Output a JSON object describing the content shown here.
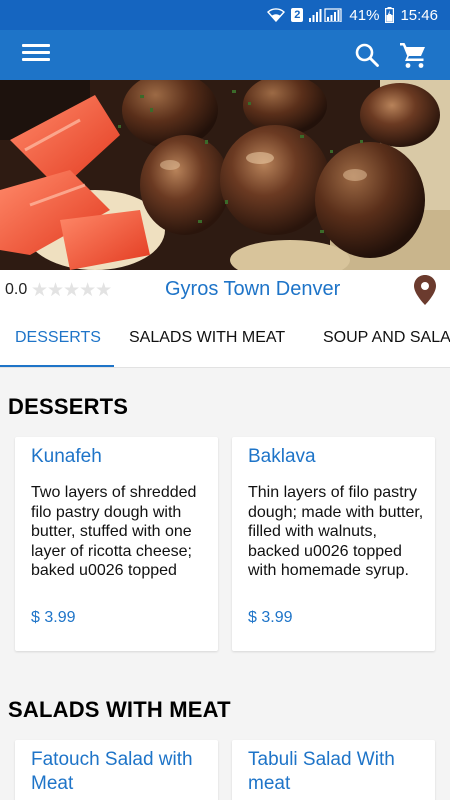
{
  "status_bar": {
    "sim_slot": "2",
    "battery": "41%",
    "time": "15:46"
  },
  "icons": {
    "menu": "menu-icon",
    "search": "search-icon",
    "cart": "cart-icon",
    "location": "location-pin-icon"
  },
  "colors": {
    "primary": "#1e74c8",
    "status_bar": "#1565c0",
    "location_pin": "#6b3b2e"
  },
  "restaurant": {
    "rating_value": "0.0",
    "rating_stars": 0,
    "name": "Gyros Town Denver"
  },
  "tabs": [
    {
      "label": "DESSERTS",
      "active": true
    },
    {
      "label": "SALADS WITH MEAT",
      "active": false
    },
    {
      "label": "SOUP AND SALAD",
      "active": false
    }
  ],
  "sections": [
    {
      "title": "DESSERTS",
      "items": [
        {
          "name": "Kunafeh",
          "description": "Two layers of shredded filo pastry dough with butter, stuffed with one layer of ricotta cheese; baked u0026 topped",
          "price": "$ 3.99"
        },
        {
          "name": "Baklava",
          "description": "Thin layers of filo pastry dough; made with butter, filled with walnuts, backed u0026 topped with homemade syrup.",
          "price": "$ 3.99"
        }
      ]
    },
    {
      "title": "SALADS WITH MEAT",
      "items": [
        {
          "name": "Fatouch Salad with Meat"
        },
        {
          "name": "Tabuli Salad With meat"
        }
      ]
    }
  ]
}
